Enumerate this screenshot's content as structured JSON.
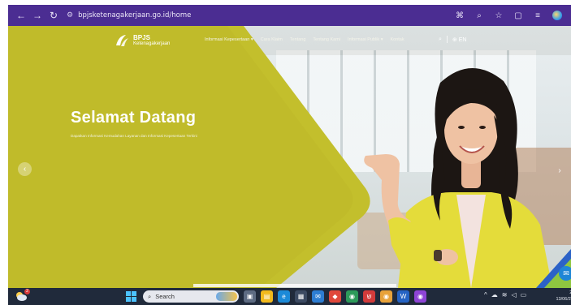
{
  "browser": {
    "url": "bpjsketenagakerjaan.go.id/home",
    "nav_icons": [
      "back-arrow-icon",
      "forward-arrow-icon",
      "reload-icon"
    ],
    "toolbar_icons": [
      "translate-icon",
      "zoom-icon",
      "bookmark-star-icon",
      "extensions-icon",
      "media-icon",
      "profile-icon"
    ]
  },
  "site": {
    "logo_primary": "BPJS",
    "logo_secondary": "Ketenagakerjaan",
    "menu": [
      "Informasi Kepesertaan ▾",
      "Cara Klaim",
      "Tentang",
      "Tentang Kami",
      "Informasi Publik ▾",
      "Kontak"
    ],
    "language": "EN"
  },
  "hero": {
    "title": "Selamat Datang",
    "subtitle": "Dapatkan Informasi Kemudahan Layanan dan Informasi Kepesertaan Terkini",
    "prev_arrow": "‹",
    "next_arrow": "›"
  },
  "taskbar": {
    "search_placeholder": "Search",
    "notification_count": "2",
    "time": "23:1",
    "date": "13/06/2023"
  },
  "colors": {
    "chrome": "#4b2d92",
    "hero_green": "#c3bf2c",
    "taskbar": "#202a3b",
    "jacket": "#e4dc3a"
  }
}
